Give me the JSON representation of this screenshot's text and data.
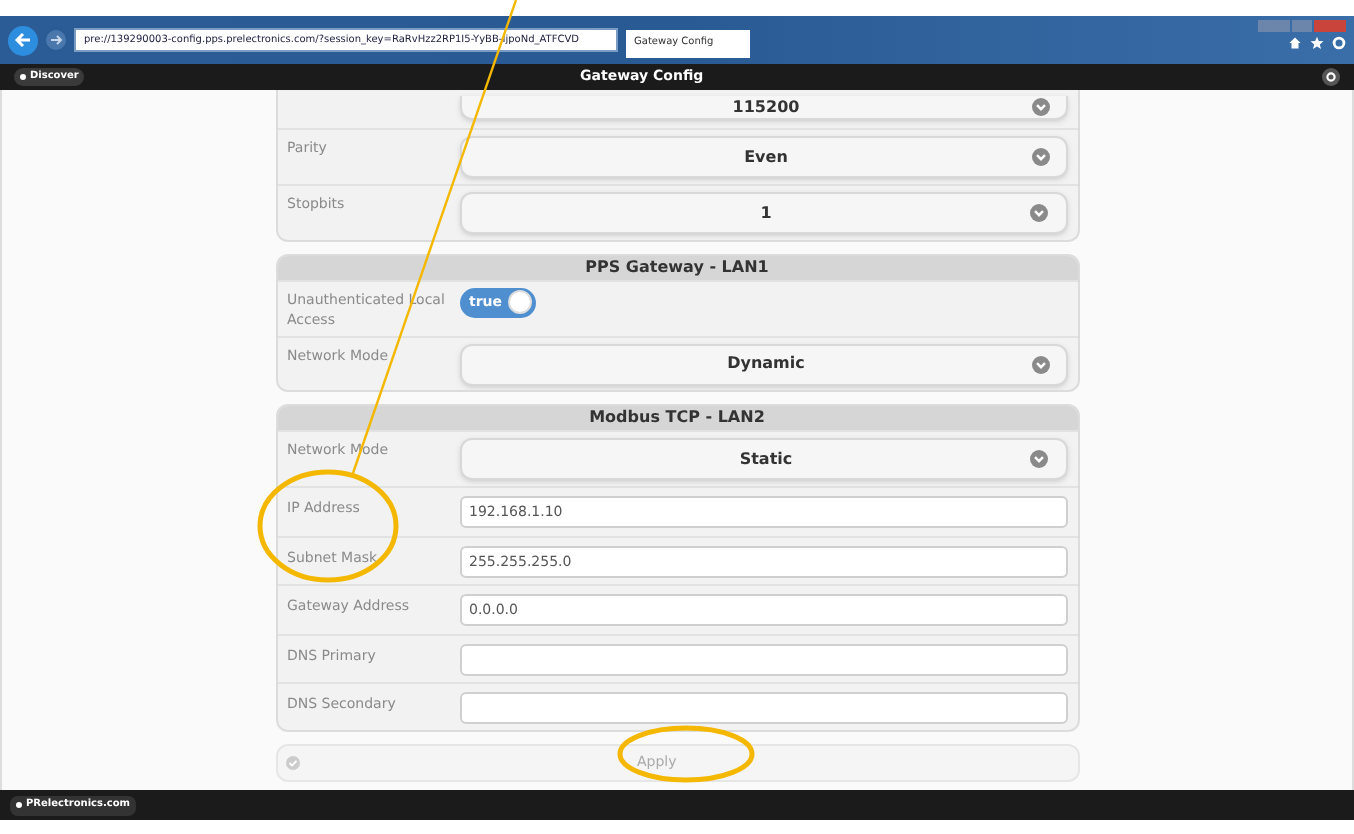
{
  "browser": {
    "url": "pre://139290003-config.pps.prelectronics.com/?session_key=RaRvHzz2RP1I5-YyBB-IjpoNd_ATFCVD",
    "tab_title": "Gateway Config"
  },
  "app_header": {
    "discover_button": "Discover",
    "title": "Gateway Config"
  },
  "sections": [
    {
      "rows": [
        {
          "kind": "select",
          "value": "115200",
          "partial": true
        },
        {
          "kind": "select",
          "label": "Parity",
          "value": "Even"
        },
        {
          "kind": "select",
          "label": "Stopbits",
          "value": "1"
        }
      ]
    },
    {
      "title": "PPS Gateway - LAN1",
      "rows": [
        {
          "kind": "toggle",
          "label": "Unauthenticated Local Access",
          "value": "true",
          "on": true
        },
        {
          "kind": "select",
          "label": "Network Mode",
          "value": "Dynamic"
        }
      ]
    },
    {
      "title": "Modbus TCP - LAN2",
      "rows": [
        {
          "kind": "select",
          "label": "Network Mode",
          "value": "Static"
        },
        {
          "kind": "text",
          "label": "IP Address",
          "value": "192.168.1.10"
        },
        {
          "kind": "text",
          "label": "Subnet Mask",
          "value": "255.255.255.0"
        },
        {
          "kind": "text",
          "label": "Gateway Address",
          "value": "0.0.0.0"
        },
        {
          "kind": "text",
          "label": "DNS Primary"
        },
        {
          "kind": "text",
          "label": "DNS Secondary"
        }
      ]
    }
  ],
  "apply_button": {
    "label": "Apply",
    "disabled": true
  },
  "footer": {
    "link": "PRelectronics.com"
  }
}
